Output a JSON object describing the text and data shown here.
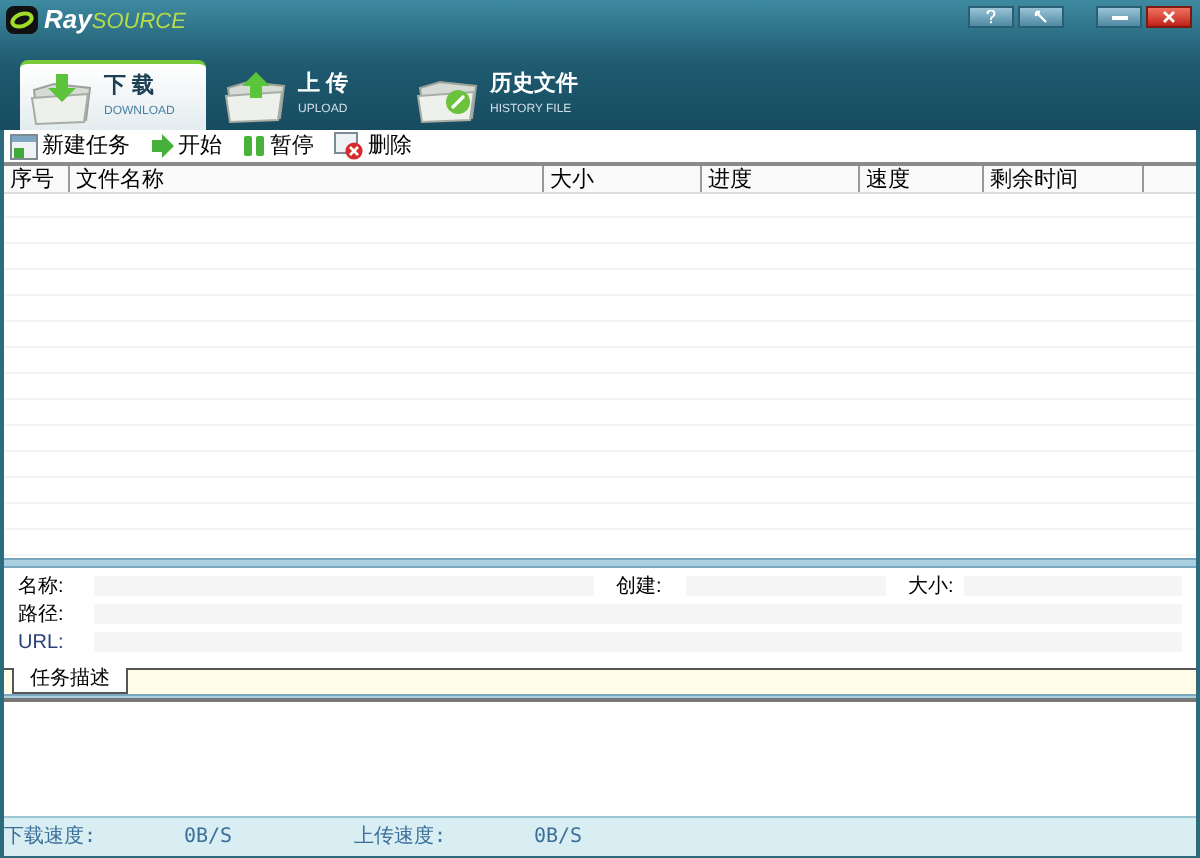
{
  "window": {
    "logo": {
      "part_1": "Ray",
      "part_2": "SOURCE"
    }
  },
  "tabs": [
    {
      "label": "下 载",
      "sublabel": "DOWNLOAD",
      "kind": "download",
      "selected": true
    },
    {
      "label": "上 传",
      "sublabel": "UPLOAD",
      "kind": "upload",
      "selected": false
    },
    {
      "label": "历史文件",
      "sublabel": "HISTORY FILE",
      "kind": "history",
      "selected": false
    }
  ],
  "toolbar": [
    {
      "label": "新建任务",
      "kind": "new"
    },
    {
      "label": "开始",
      "kind": "start"
    },
    {
      "label": "暂停",
      "kind": "pause"
    },
    {
      "label": "删除",
      "kind": "delete"
    }
  ],
  "table": {
    "columns": [
      "序号",
      "文件名称",
      "大小",
      "进度",
      "速度",
      "剩余时间"
    ]
  },
  "details": {
    "fields": [
      {
        "label": "名称:"
      },
      {
        "label": "创建:"
      },
      {
        "label": "大小:"
      },
      {
        "label": "路径:"
      },
      {
        "label": "URL:"
      }
    ],
    "tabs": [
      {
        "label": "任务描述",
        "selected": true
      }
    ]
  },
  "status_bar": [
    {
      "label": "下载速度:",
      "value": "0B/S"
    },
    {
      "label": "上传速度:",
      "value": "0B/S"
    }
  ]
}
